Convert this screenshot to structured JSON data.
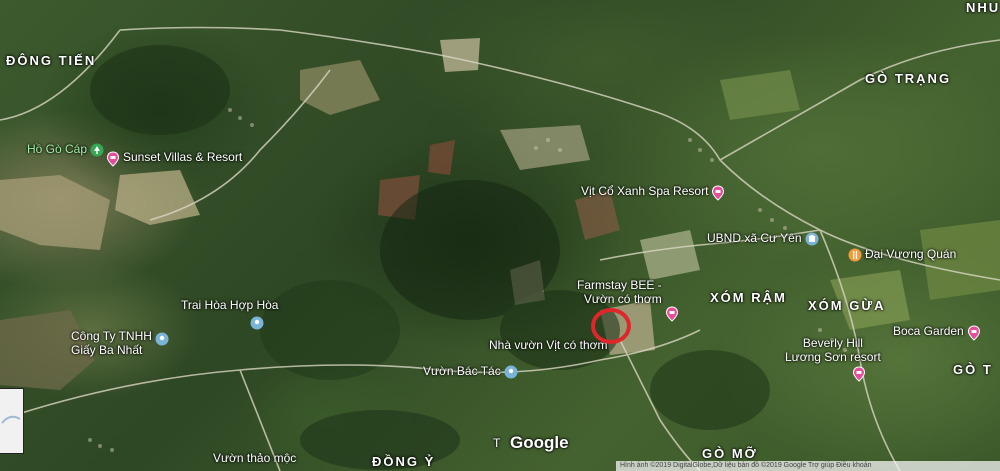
{
  "map": {
    "type": "satellite",
    "provider": "Google",
    "logo_text": "Google",
    "attribution": "Hình ảnh ©2019 DigitalGlobe,Dữ liệu bản đồ ©2019 Google    Trợ giúp    Điều khoản",
    "district_labels": [
      {
        "id": "dong-tien",
        "text": "ĐÔNG TIẾN"
      },
      {
        "id": "go-trang",
        "text": "GÒ TRẠNG"
      },
      {
        "id": "xom-ram",
        "text": "XÓM RẬM"
      },
      {
        "id": "xom-gua",
        "text": "XÓM GỪA"
      },
      {
        "id": "go-t",
        "text": "GÒ T"
      },
      {
        "id": "dong-y",
        "text": "ĐỒNG Ỷ"
      },
      {
        "id": "go-mo",
        "text": "GÒ MỠ"
      },
      {
        "id": "nhu",
        "text": "NHU"
      }
    ],
    "pois": [
      {
        "id": "ho-go-cap",
        "label": "Hồ Gò Cáp",
        "icon": "park-icon",
        "color": "#34a853"
      },
      {
        "id": "sunset-villas",
        "label": "Sunset Villas & Resort",
        "icon": "hotel-pin-icon",
        "color": "#e44d9c"
      },
      {
        "id": "vit-co-xanh",
        "label": "Vịt Cổ Xanh Spa Resort",
        "icon": "hotel-pin-icon",
        "color": "#e44d9c"
      },
      {
        "id": "ubnd",
        "label": "UBND xã Cư Yên",
        "icon": "government-icon",
        "color": "#7ab3d8"
      },
      {
        "id": "dai-vuong",
        "label": "Đại Vương Quán",
        "icon": "restaurant-icon",
        "color": "#f29b3a"
      },
      {
        "id": "farmstay-bee",
        "label_lines": [
          "Farmstay BEE -",
          "Vườn có thơm"
        ],
        "icon": "hotel-pin-icon",
        "color": "#e44d9c"
      },
      {
        "id": "trai-hoa",
        "label": "Trai Hòa Hợp Hòa",
        "icon": "place-icon",
        "color": "#7ab3d8"
      },
      {
        "id": "cong-ty",
        "label_lines": [
          "Công Ty TNHH",
          "Giấy Ba Nhất"
        ],
        "icon": "place-icon",
        "color": "#7ab3d8"
      },
      {
        "id": "nha-vuon",
        "label": "Nhà vườn Vịt có thơm",
        "icon": "none",
        "color": "#ffffff"
      },
      {
        "id": "vuon-bac-tac",
        "label": "Vườn Bác Tác",
        "icon": "place-icon",
        "color": "#7ab3d8"
      },
      {
        "id": "boca-garden",
        "label": "Boca Garden",
        "icon": "hotel-pin-icon",
        "color": "#e44d9c"
      },
      {
        "id": "beverly-hill",
        "label_lines": [
          "Beverly Hill",
          "Lương Sơn resort"
        ],
        "icon": "hotel-pin-icon",
        "color": "#e44d9c"
      },
      {
        "id": "vuon-thao-moc",
        "label": "Vườn thảo mộc",
        "icon": "none",
        "color": "#ffffff"
      },
      {
        "id": "t-label",
        "label": "T",
        "icon": "none",
        "color": "#ffffff"
      }
    ],
    "highlight": {
      "shape": "circle",
      "color": "#e0262b"
    }
  }
}
